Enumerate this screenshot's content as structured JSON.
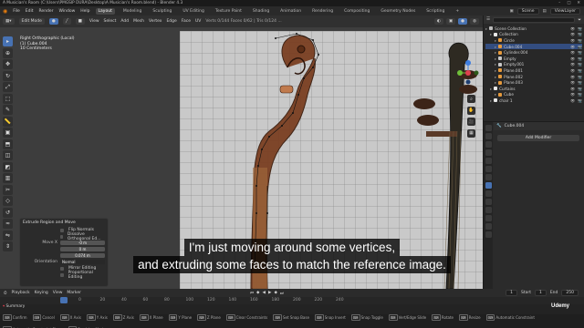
{
  "window": {
    "title": "A Musician's Room (C:\\Users\\PMGSIP DURA\\Desktop\\A Musician's Room.blend) - Blender 4.3",
    "controls": [
      "–",
      "□",
      "✕"
    ]
  },
  "menubar": {
    "file_menus": [
      "File",
      "Edit",
      "Render",
      "Window",
      "Help"
    ],
    "workspaces": [
      "Layout",
      "Modeling",
      "Sculpting",
      "UV Editing",
      "Texture Paint",
      "Shading",
      "Animation",
      "Rendering",
      "Compositing",
      "Geometry Nodes",
      "Scripting",
      "+"
    ],
    "active_workspace": "Layout",
    "scene": "Scene",
    "view_layer": "ViewLayer"
  },
  "viewport_header": {
    "mode": "Edit Mode",
    "menus": [
      "View",
      "Select",
      "Add",
      "Mesh",
      "Vertex",
      "Edge",
      "Face",
      "UV"
    ],
    "stats": "Verts 0/144  Faces 0/62 | Tris 0/124 ..."
  },
  "viewport_info": {
    "view": "Right Orthographic (Local)",
    "object": "(1) Cube.004",
    "scale": "10 Centimeters"
  },
  "operator_panel": {
    "title": "Extrude Region and Move",
    "flip_normals": "Flip Normals",
    "dissolve": "Dissolve Orthogonal Ed...",
    "move_label": "Move X",
    "move_x": "-0 m",
    "move_y": "0 m",
    "move_z": "0.074 m",
    "orientation_label": "Orientation",
    "orientation_value": "Normal",
    "mirror": "Mirror Editing",
    "proportional": "Proportional Editing"
  },
  "overlay_letters": [
    "E",
    "G"
  ],
  "subtitles": {
    "line1": "I'm just moving around some vertices,",
    "line2": "and extruding some faces to match the reference image."
  },
  "outliner": {
    "header": "Scene Collection",
    "items": [
      {
        "label": "Scene Collection",
        "level": 0,
        "color": "#bdbdbd",
        "selected": false
      },
      {
        "label": "Collection",
        "level": 1,
        "color": "#e8e8e8",
        "selected": false
      },
      {
        "label": "Circle",
        "level": 2,
        "color": "#e69a3c",
        "selected": false
      },
      {
        "label": "Cube.004",
        "level": 2,
        "color": "#e69a3c",
        "selected": true
      },
      {
        "label": "Cylinder.004",
        "level": 2,
        "color": "#e69a3c",
        "selected": false
      },
      {
        "label": "Empty",
        "level": 2,
        "color": "#c9c9c9",
        "selected": false
      },
      {
        "label": "Empty.001",
        "level": 2,
        "color": "#c9c9c9",
        "selected": false
      },
      {
        "label": "Plane.001",
        "level": 2,
        "color": "#e69a3c",
        "selected": false
      },
      {
        "label": "Plane.002",
        "level": 2,
        "color": "#e69a3c",
        "selected": false
      },
      {
        "label": "Plane.003",
        "level": 2,
        "color": "#e69a3c",
        "selected": false
      },
      {
        "label": "Curtains",
        "level": 1,
        "color": "#e8e8e8",
        "selected": false
      },
      {
        "label": "Cube",
        "level": 2,
        "color": "#e69a3c",
        "selected": false
      },
      {
        "label": "chair 1",
        "level": 1,
        "color": "#e8e8e8",
        "selected": false
      }
    ]
  },
  "properties": {
    "object_name": "Cube.004",
    "add_modifier": "Add Modifier"
  },
  "timeline": {
    "menus": [
      "Playback",
      "Keying",
      "View",
      "Marker"
    ],
    "current_frame": "1",
    "start_label": "Start",
    "start": "1",
    "end_label": "End",
    "end": "250",
    "ruler_ticks": [
      "0",
      "20",
      "40",
      "60",
      "80",
      "100",
      "120",
      "140",
      "160",
      "180",
      "200",
      "220",
      "240"
    ],
    "summary": "Summary"
  },
  "statusbar": {
    "items": [
      "Confirm",
      "Cancel",
      "X Axis",
      "Y Axis",
      "Z Axis",
      "X Plane",
      "Y Plane",
      "Z Plane",
      "Clear Constraints",
      "Set Snap Base",
      "Snap Invert",
      "Snap Toggle",
      "Vert/Edge Slide",
      "Rotate",
      "Resize",
      "Automatic Constraint",
      "Automatic Constraint Plane",
      "Precision Mode"
    ]
  },
  "watermark": "Udemy",
  "colors": {
    "accent": "#4772b3",
    "selected_row": "#334d80",
    "object_orange": "#e69a3c",
    "axis_red": "#e0404f",
    "axis_green": "#6fbf3a",
    "axis_blue": "#3d7de0"
  }
}
